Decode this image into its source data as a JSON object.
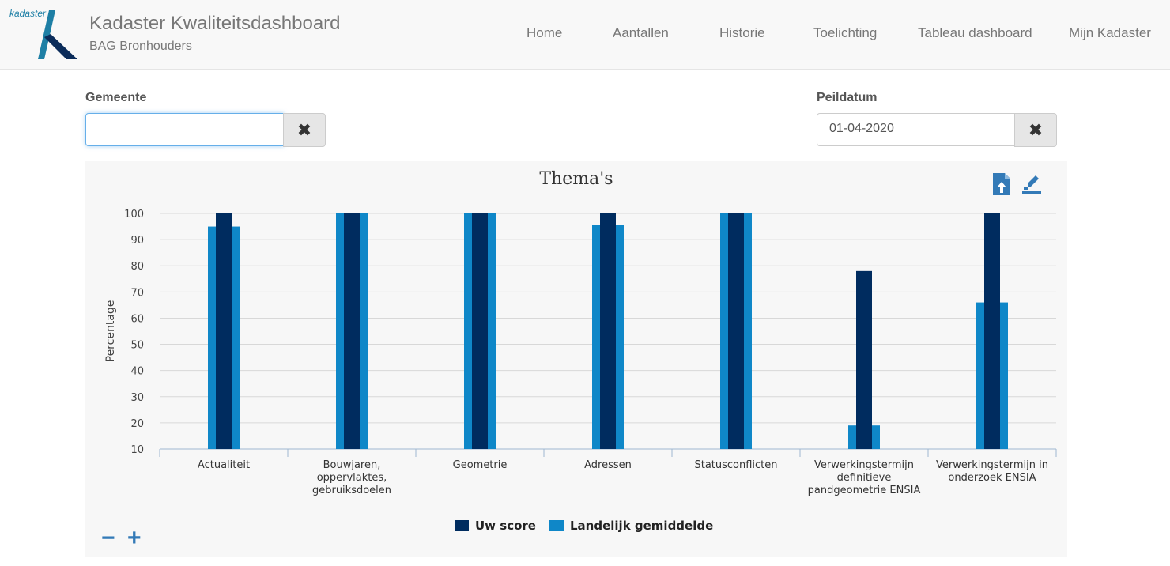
{
  "header": {
    "logo_text": "kadaster",
    "title": "Kadaster Kwaliteitsdashboard",
    "subtitle": "BAG Bronhouders",
    "nav": [
      "Home",
      "Aantallen",
      "Historie",
      "Toelichting",
      "Tableau dashboard",
      "Mijn Kadaster"
    ]
  },
  "filters": {
    "gemeente_label": "Gemeente",
    "gemeente_value": "",
    "peildatum_label": "Peildatum",
    "peildatum_value": "01-04-2020",
    "clear_glyph": "✖"
  },
  "colors": {
    "uw_score": "#002c5f",
    "landelijk": "#0f87c8",
    "accent": "#337ab7"
  },
  "chart_data": {
    "type": "bar",
    "title": "Thema's",
    "ylabel": "Percentage",
    "xlabel": "",
    "ylim": [
      10,
      100
    ],
    "yticks": [
      10,
      20,
      30,
      40,
      50,
      60,
      70,
      80,
      90,
      100
    ],
    "grid": true,
    "legend_position": "bottom-center",
    "categories": [
      [
        "Actualiteit"
      ],
      [
        "Bouwjaren,",
        "oppervlaktes,",
        "gebruiksdoelen"
      ],
      [
        "Geometrie"
      ],
      [
        "Adressen"
      ],
      [
        "Statusconflicten"
      ],
      [
        "Verwerkingstermijn",
        "definitieve",
        "pandgeometrie ENSIA"
      ],
      [
        "Verwerkingstermijn in",
        "onderzoek ENSIA"
      ]
    ],
    "series": [
      {
        "name": "Landelijk gemiddelde",
        "values": [
          95,
          100,
          100,
          95.5,
          100,
          19,
          66
        ]
      },
      {
        "name": "Uw score",
        "values": [
          100,
          100,
          100,
          100,
          100,
          78,
          100
        ]
      }
    ]
  },
  "zoom": {
    "minus": "−",
    "plus": "+"
  }
}
